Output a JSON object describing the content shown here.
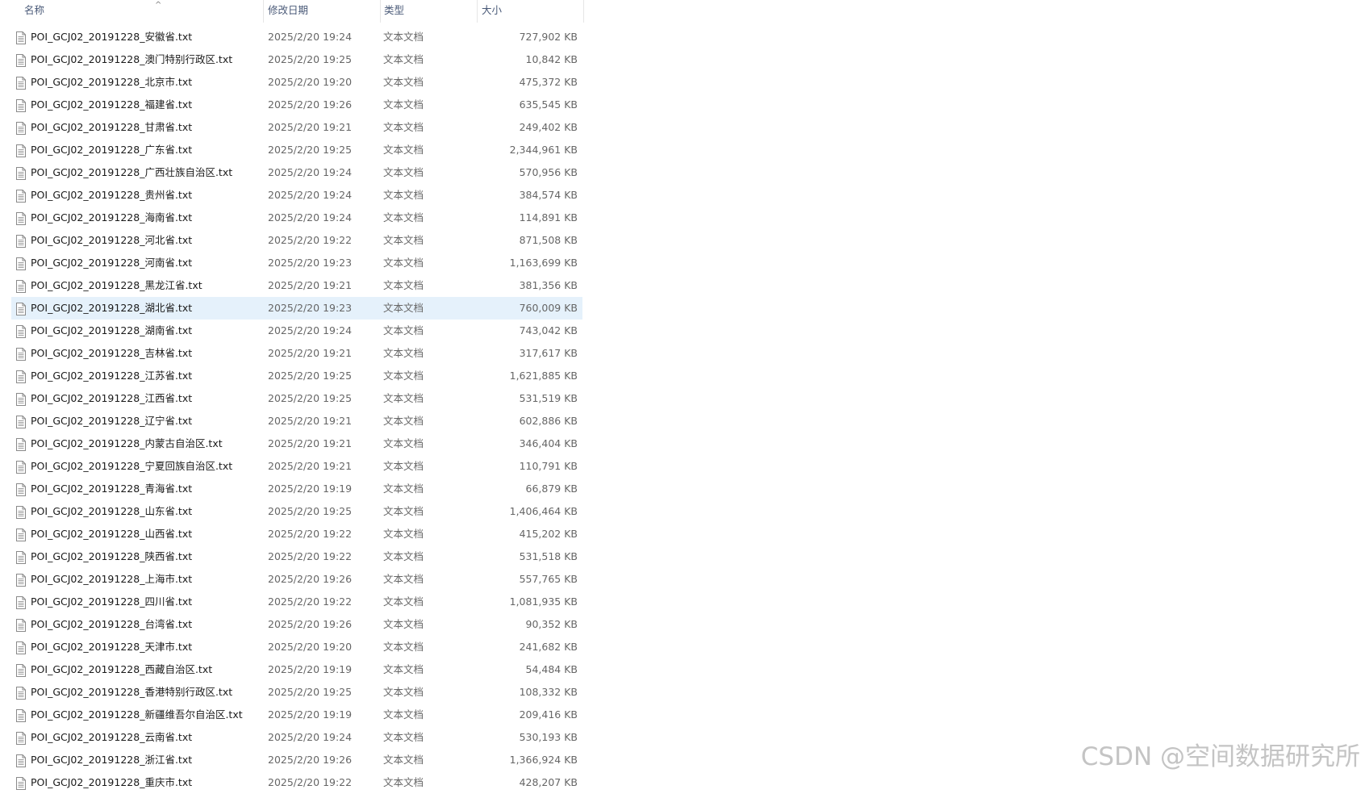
{
  "columns": {
    "name": "名称",
    "date": "修改日期",
    "type": "类型",
    "size": "大小",
    "sort_indicator": "^"
  },
  "selected_index": 12,
  "files": [
    {
      "name": "POI_GCJ02_20191228_安徽省.txt",
      "date": "2025/2/20 19:24",
      "type": "文本文档",
      "size": "727,902 KB"
    },
    {
      "name": "POI_GCJ02_20191228_澳门特别行政区.txt",
      "date": "2025/2/20 19:25",
      "type": "文本文档",
      "size": "10,842 KB"
    },
    {
      "name": "POI_GCJ02_20191228_北京市.txt",
      "date": "2025/2/20 19:20",
      "type": "文本文档",
      "size": "475,372 KB"
    },
    {
      "name": "POI_GCJ02_20191228_福建省.txt",
      "date": "2025/2/20 19:26",
      "type": "文本文档",
      "size": "635,545 KB"
    },
    {
      "name": "POI_GCJ02_20191228_甘肃省.txt",
      "date": "2025/2/20 19:21",
      "type": "文本文档",
      "size": "249,402 KB"
    },
    {
      "name": "POI_GCJ02_20191228_广东省.txt",
      "date": "2025/2/20 19:25",
      "type": "文本文档",
      "size": "2,344,961 KB"
    },
    {
      "name": "POI_GCJ02_20191228_广西壮族自治区.txt",
      "date": "2025/2/20 19:24",
      "type": "文本文档",
      "size": "570,956 KB"
    },
    {
      "name": "POI_GCJ02_20191228_贵州省.txt",
      "date": "2025/2/20 19:24",
      "type": "文本文档",
      "size": "384,574 KB"
    },
    {
      "name": "POI_GCJ02_20191228_海南省.txt",
      "date": "2025/2/20 19:24",
      "type": "文本文档",
      "size": "114,891 KB"
    },
    {
      "name": "POI_GCJ02_20191228_河北省.txt",
      "date": "2025/2/20 19:22",
      "type": "文本文档",
      "size": "871,508 KB"
    },
    {
      "name": "POI_GCJ02_20191228_河南省.txt",
      "date": "2025/2/20 19:23",
      "type": "文本文档",
      "size": "1,163,699 KB"
    },
    {
      "name": "POI_GCJ02_20191228_黑龙江省.txt",
      "date": "2025/2/20 19:21",
      "type": "文本文档",
      "size": "381,356 KB"
    },
    {
      "name": "POI_GCJ02_20191228_湖北省.txt",
      "date": "2025/2/20 19:23",
      "type": "文本文档",
      "size": "760,009 KB"
    },
    {
      "name": "POI_GCJ02_20191228_湖南省.txt",
      "date": "2025/2/20 19:24",
      "type": "文本文档",
      "size": "743,042 KB"
    },
    {
      "name": "POI_GCJ02_20191228_吉林省.txt",
      "date": "2025/2/20 19:21",
      "type": "文本文档",
      "size": "317,617 KB"
    },
    {
      "name": "POI_GCJ02_20191228_江苏省.txt",
      "date": "2025/2/20 19:25",
      "type": "文本文档",
      "size": "1,621,885 KB"
    },
    {
      "name": "POI_GCJ02_20191228_江西省.txt",
      "date": "2025/2/20 19:25",
      "type": "文本文档",
      "size": "531,519 KB"
    },
    {
      "name": "POI_GCJ02_20191228_辽宁省.txt",
      "date": "2025/2/20 19:21",
      "type": "文本文档",
      "size": "602,886 KB"
    },
    {
      "name": "POI_GCJ02_20191228_内蒙古自治区.txt",
      "date": "2025/2/20 19:21",
      "type": "文本文档",
      "size": "346,404 KB"
    },
    {
      "name": "POI_GCJ02_20191228_宁夏回族自治区.txt",
      "date": "2025/2/20 19:21",
      "type": "文本文档",
      "size": "110,791 KB"
    },
    {
      "name": "POI_GCJ02_20191228_青海省.txt",
      "date": "2025/2/20 19:19",
      "type": "文本文档",
      "size": "66,879 KB"
    },
    {
      "name": "POI_GCJ02_20191228_山东省.txt",
      "date": "2025/2/20 19:25",
      "type": "文本文档",
      "size": "1,406,464 KB"
    },
    {
      "name": "POI_GCJ02_20191228_山西省.txt",
      "date": "2025/2/20 19:22",
      "type": "文本文档",
      "size": "415,202 KB"
    },
    {
      "name": "POI_GCJ02_20191228_陕西省.txt",
      "date": "2025/2/20 19:22",
      "type": "文本文档",
      "size": "531,518 KB"
    },
    {
      "name": "POI_GCJ02_20191228_上海市.txt",
      "date": "2025/2/20 19:26",
      "type": "文本文档",
      "size": "557,765 KB"
    },
    {
      "name": "POI_GCJ02_20191228_四川省.txt",
      "date": "2025/2/20 19:22",
      "type": "文本文档",
      "size": "1,081,935 KB"
    },
    {
      "name": "POI_GCJ02_20191228_台湾省.txt",
      "date": "2025/2/20 19:26",
      "type": "文本文档",
      "size": "90,352 KB"
    },
    {
      "name": "POI_GCJ02_20191228_天津市.txt",
      "date": "2025/2/20 19:20",
      "type": "文本文档",
      "size": "241,682 KB"
    },
    {
      "name": "POI_GCJ02_20191228_西藏自治区.txt",
      "date": "2025/2/20 19:19",
      "type": "文本文档",
      "size": "54,484 KB"
    },
    {
      "name": "POI_GCJ02_20191228_香港特别行政区.txt",
      "date": "2025/2/20 19:25",
      "type": "文本文档",
      "size": "108,332 KB"
    },
    {
      "name": "POI_GCJ02_20191228_新疆维吾尔自治区.txt",
      "date": "2025/2/20 19:19",
      "type": "文本文档",
      "size": "209,416 KB"
    },
    {
      "name": "POI_GCJ02_20191228_云南省.txt",
      "date": "2025/2/20 19:24",
      "type": "文本文档",
      "size": "530,193 KB"
    },
    {
      "name": "POI_GCJ02_20191228_浙江省.txt",
      "date": "2025/2/20 19:26",
      "type": "文本文档",
      "size": "1,366,924 KB"
    },
    {
      "name": "POI_GCJ02_20191228_重庆市.txt",
      "date": "2025/2/20 19:22",
      "type": "文本文档",
      "size": "428,207 KB"
    }
  ],
  "watermark": "CSDN @空间数据研究所"
}
